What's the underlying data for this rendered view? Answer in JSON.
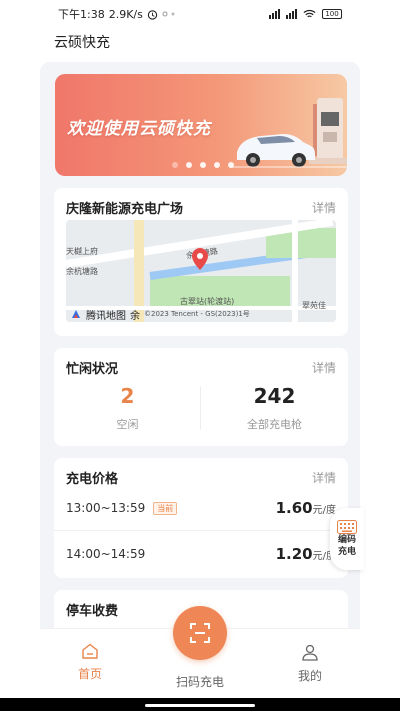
{
  "status": {
    "time": "下午1:38",
    "speed": "2.9K/s",
    "battery": "100"
  },
  "app": {
    "title": "云硕快充"
  },
  "banner": {
    "text": "欢迎使用云硕快充",
    "dots": 5,
    "active_dot": 0
  },
  "station": {
    "name": "庆隆新能源充电广场",
    "detail": "详情",
    "map": {
      "labels": [
        "天樾上府",
        "余杭塘路",
        "余杭塘路",
        "古翠站(轮渡站)",
        "翠苑佳",
        "腾讯地图",
        "余",
        "©2023 Tencent - GS(2023)1号"
      ]
    }
  },
  "busy": {
    "title": "忙闲状况",
    "detail": "详情",
    "idle_count": "2",
    "idle_label": "空闲",
    "total_count": "242",
    "total_label": "全部充电枪"
  },
  "price": {
    "title": "充电价格",
    "detail": "详情",
    "rows": [
      {
        "time": "13:00~13:59",
        "tag": "当前",
        "value": "1.60",
        "unit": "元/度"
      },
      {
        "time": "14:00~14:59",
        "tag": "",
        "value": "1.20",
        "unit": "元/度"
      }
    ]
  },
  "parking": {
    "title": "停车收费"
  },
  "float_button": {
    "line1": "编码",
    "line2": "充电"
  },
  "tabs": {
    "home": "首页",
    "scan": "扫码充电",
    "mine": "我的"
  },
  "colors": {
    "accent": "#ee8755",
    "idle_number": "#e8834a",
    "banner_start": "#f0776a",
    "banner_end": "#f6c9a4"
  }
}
